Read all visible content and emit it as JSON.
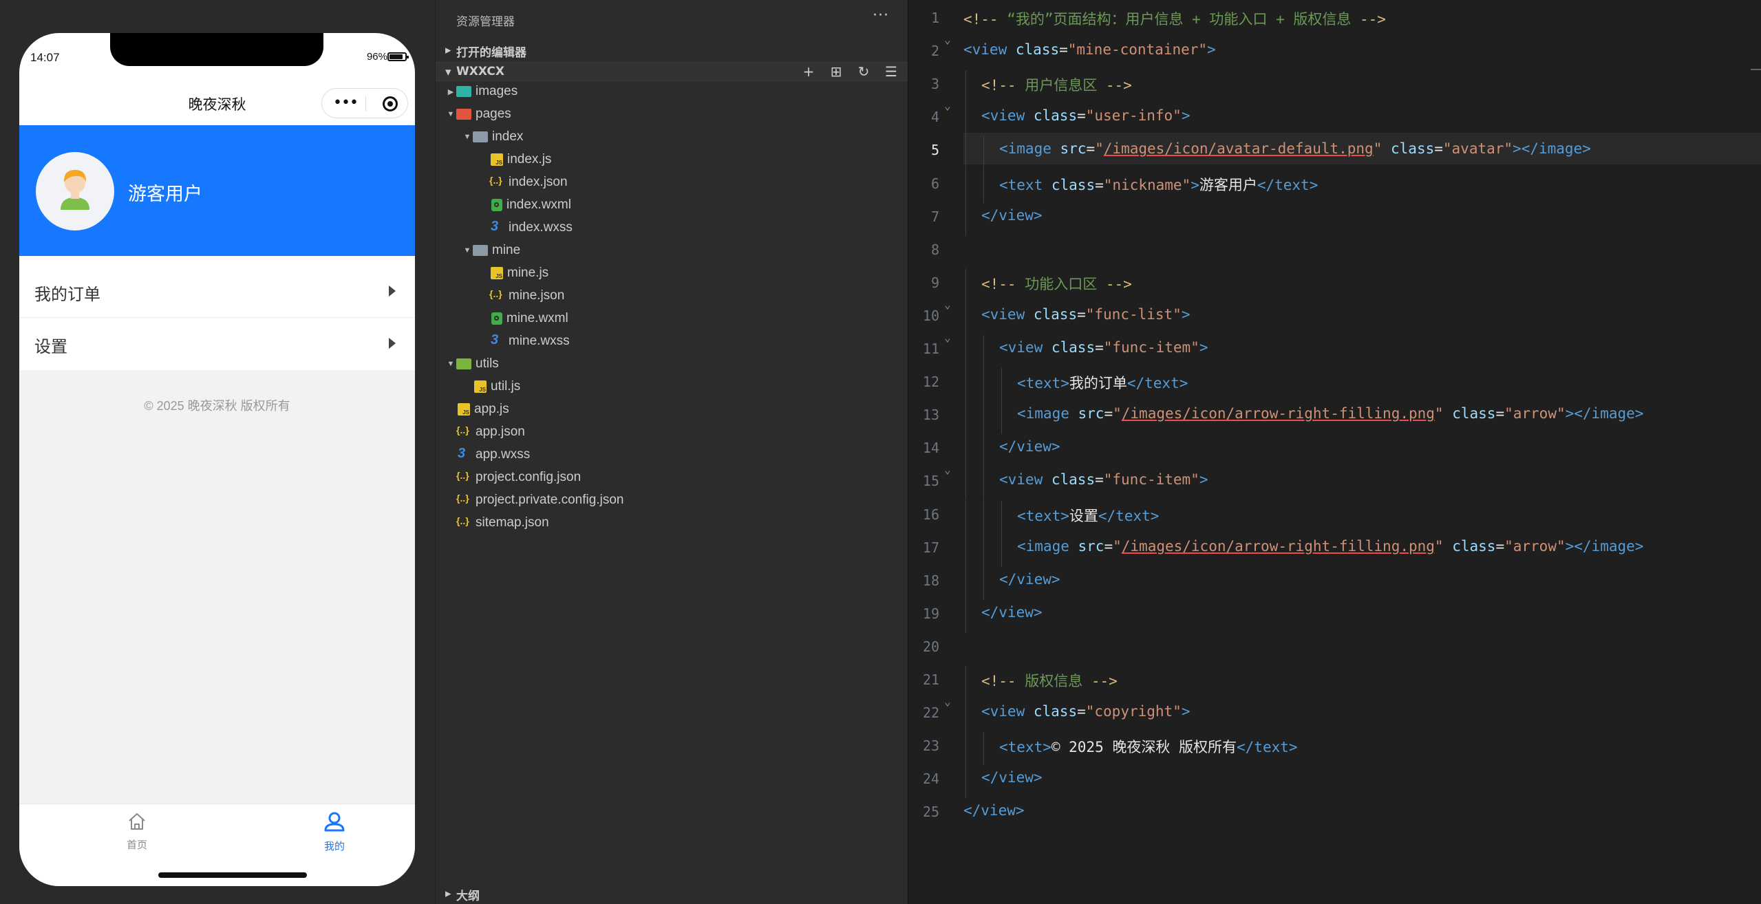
{
  "simulator": {
    "status_time": "14:07",
    "battery": "96%",
    "nav_title": "晚夜深秋",
    "user": {
      "nickname": "游客用户"
    },
    "func_items": [
      {
        "label": "我的订单"
      },
      {
        "label": "设置"
      }
    ],
    "copyright": "© 2025 晚夜深秋 版权所有",
    "tabs": [
      {
        "label": "首页"
      },
      {
        "label": "我的"
      }
    ],
    "colors": {
      "primary": "#1677ff",
      "page_bg": "#f2f2f2"
    }
  },
  "explorer": {
    "title": "资源管理器",
    "more": "···",
    "open_editors": "打开的编辑器",
    "project": "WXXCX",
    "outline": "大纲",
    "tree": [
      {
        "name": "images",
        "type": "folder-img",
        "depth": 0,
        "state": "collapsed"
      },
      {
        "name": "pages",
        "type": "folder-pages",
        "depth": 0,
        "state": "expanded"
      },
      {
        "name": "index",
        "type": "folder",
        "depth": 1,
        "state": "expanded"
      },
      {
        "name": "index.js",
        "type": "js",
        "depth": 2
      },
      {
        "name": "index.json",
        "type": "json",
        "depth": 2
      },
      {
        "name": "index.wxml",
        "type": "wxml",
        "depth": 2
      },
      {
        "name": "index.wxss",
        "type": "wxss",
        "depth": 2
      },
      {
        "name": "mine",
        "type": "folder",
        "depth": 1,
        "state": "expanded"
      },
      {
        "name": "mine.js",
        "type": "js",
        "depth": 2
      },
      {
        "name": "mine.json",
        "type": "json",
        "depth": 2
      },
      {
        "name": "mine.wxml",
        "type": "wxml",
        "depth": 2
      },
      {
        "name": "mine.wxss",
        "type": "wxss",
        "depth": 2
      },
      {
        "name": "utils",
        "type": "folder-utils",
        "depth": 0,
        "state": "expanded"
      },
      {
        "name": "util.js",
        "type": "js",
        "depth": 1
      },
      {
        "name": "app.js",
        "type": "js",
        "depth": 0
      },
      {
        "name": "app.json",
        "type": "json",
        "depth": 0
      },
      {
        "name": "app.wxss",
        "type": "wxss",
        "depth": 0
      },
      {
        "name": "project.config.json",
        "type": "json",
        "depth": 0
      },
      {
        "name": "project.private.config.json",
        "type": "json",
        "depth": 0
      },
      {
        "name": "sitemap.json",
        "type": "json",
        "depth": 0
      }
    ]
  },
  "editor": {
    "active_line": 5,
    "lines": [
      {
        "indent": 0,
        "tokens": [
          [
            "cmp",
            "<!-- "
          ],
          [
            "cm",
            "“我的”页面结构：用户信息 + 功能入口 + 版权信息"
          ],
          [
            "cmp",
            " -->"
          ]
        ]
      },
      {
        "indent": 0,
        "fold": true,
        "tokens": [
          [
            "tag",
            "<view"
          ],
          [
            "txt",
            " "
          ],
          [
            "attr",
            "class"
          ],
          [
            "txt",
            "="
          ],
          [
            "str",
            "\"mine-container\""
          ],
          [
            "tag",
            ">"
          ]
        ]
      },
      {
        "indent": 1,
        "tokens": [
          [
            "cmp",
            "<!-- "
          ],
          [
            "cm",
            "用户信息区"
          ],
          [
            "cmp",
            " -->"
          ]
        ]
      },
      {
        "indent": 1,
        "fold": true,
        "tokens": [
          [
            "tag",
            "<view"
          ],
          [
            "txt",
            " "
          ],
          [
            "attr",
            "class"
          ],
          [
            "txt",
            "="
          ],
          [
            "str",
            "\"user-info\""
          ],
          [
            "tag",
            ">"
          ]
        ]
      },
      {
        "indent": 2,
        "tokens": [
          [
            "tag",
            "<image"
          ],
          [
            "txt",
            " "
          ],
          [
            "attr",
            "src"
          ],
          [
            "txt",
            "="
          ],
          [
            "str",
            "\""
          ],
          [
            "url",
            "/images/icon/avatar-default.png"
          ],
          [
            "str",
            "\""
          ],
          [
            "txt",
            " "
          ],
          [
            "attr",
            "class"
          ],
          [
            "txt",
            "="
          ],
          [
            "str",
            "\"avatar\""
          ],
          [
            "tag",
            ">"
          ],
          [
            "tag",
            "</image>"
          ]
        ]
      },
      {
        "indent": 2,
        "tokens": [
          [
            "tag",
            "<text"
          ],
          [
            "txt",
            " "
          ],
          [
            "attr",
            "class"
          ],
          [
            "txt",
            "="
          ],
          [
            "str",
            "\"nickname\""
          ],
          [
            "tag",
            ">"
          ],
          [
            "txt",
            "游客用户"
          ],
          [
            "tag",
            "</text>"
          ]
        ]
      },
      {
        "indent": 1,
        "tokens": [
          [
            "tag",
            "</view>"
          ]
        ]
      },
      {
        "indent": 0,
        "tokens": []
      },
      {
        "indent": 1,
        "tokens": [
          [
            "cmp",
            "<!-- "
          ],
          [
            "cm",
            "功能入口区"
          ],
          [
            "cmp",
            " -->"
          ]
        ]
      },
      {
        "indent": 1,
        "fold": true,
        "tokens": [
          [
            "tag",
            "<view"
          ],
          [
            "txt",
            " "
          ],
          [
            "attr",
            "class"
          ],
          [
            "txt",
            "="
          ],
          [
            "str",
            "\"func-list\""
          ],
          [
            "tag",
            ">"
          ]
        ]
      },
      {
        "indent": 2,
        "fold": true,
        "tokens": [
          [
            "tag",
            "<view"
          ],
          [
            "txt",
            " "
          ],
          [
            "attr",
            "class"
          ],
          [
            "txt",
            "="
          ],
          [
            "str",
            "\"func-item\""
          ],
          [
            "tag",
            ">"
          ]
        ]
      },
      {
        "indent": 3,
        "tokens": [
          [
            "tag",
            "<text>"
          ],
          [
            "txt",
            "我的订单"
          ],
          [
            "tag",
            "</text>"
          ]
        ]
      },
      {
        "indent": 3,
        "tokens": [
          [
            "tag",
            "<image"
          ],
          [
            "txt",
            " "
          ],
          [
            "attr",
            "src"
          ],
          [
            "txt",
            "="
          ],
          [
            "str",
            "\""
          ],
          [
            "url",
            "/images/icon/arrow-right-filling.png"
          ],
          [
            "str",
            "\""
          ],
          [
            "txt",
            " "
          ],
          [
            "attr",
            "class"
          ],
          [
            "txt",
            "="
          ],
          [
            "str",
            "\"arrow\""
          ],
          [
            "tag",
            "></image>"
          ]
        ]
      },
      {
        "indent": 2,
        "tokens": [
          [
            "tag",
            "</view>"
          ]
        ]
      },
      {
        "indent": 2,
        "fold": true,
        "tokens": [
          [
            "tag",
            "<view"
          ],
          [
            "txt",
            " "
          ],
          [
            "attr",
            "class"
          ],
          [
            "txt",
            "="
          ],
          [
            "str",
            "\"func-item\""
          ],
          [
            "tag",
            ">"
          ]
        ]
      },
      {
        "indent": 3,
        "tokens": [
          [
            "tag",
            "<text>"
          ],
          [
            "txt",
            "设置"
          ],
          [
            "tag",
            "</text>"
          ]
        ]
      },
      {
        "indent": 3,
        "tokens": [
          [
            "tag",
            "<image"
          ],
          [
            "txt",
            " "
          ],
          [
            "attr",
            "src"
          ],
          [
            "txt",
            "="
          ],
          [
            "str",
            "\""
          ],
          [
            "url",
            "/images/icon/arrow-right-filling.png"
          ],
          [
            "str",
            "\""
          ],
          [
            "txt",
            " "
          ],
          [
            "attr",
            "class"
          ],
          [
            "txt",
            "="
          ],
          [
            "str",
            "\"arrow\""
          ],
          [
            "tag",
            "></image>"
          ]
        ]
      },
      {
        "indent": 2,
        "tokens": [
          [
            "tag",
            "</view>"
          ]
        ]
      },
      {
        "indent": 1,
        "tokens": [
          [
            "tag",
            "</view>"
          ]
        ]
      },
      {
        "indent": 0,
        "tokens": []
      },
      {
        "indent": 1,
        "tokens": [
          [
            "cmp",
            "<!-- "
          ],
          [
            "cm",
            "版权信息"
          ],
          [
            "cmp",
            " -->"
          ]
        ]
      },
      {
        "indent": 1,
        "fold": true,
        "tokens": [
          [
            "tag",
            "<view"
          ],
          [
            "txt",
            " "
          ],
          [
            "attr",
            "class"
          ],
          [
            "txt",
            "="
          ],
          [
            "str",
            "\"copyright\""
          ],
          [
            "tag",
            ">"
          ]
        ]
      },
      {
        "indent": 2,
        "tokens": [
          [
            "tag",
            "<text>"
          ],
          [
            "txt",
            "© 2025 晚夜深秋 版权所有"
          ],
          [
            "tag",
            "</text>"
          ]
        ]
      },
      {
        "indent": 1,
        "tokens": [
          [
            "tag",
            "</view>"
          ]
        ]
      },
      {
        "indent": 0,
        "tokens": [
          [
            "tag",
            "</view>"
          ]
        ]
      }
    ]
  }
}
